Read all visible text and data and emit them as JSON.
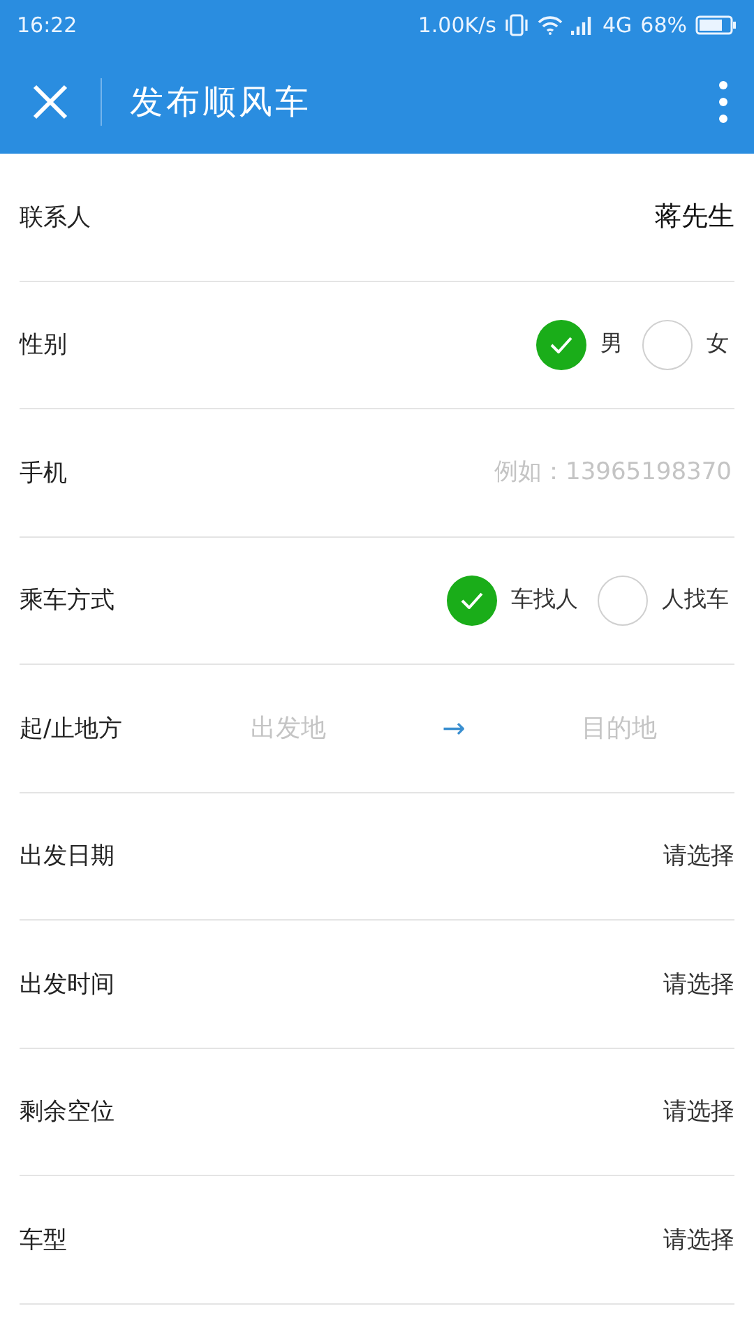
{
  "status_bar": {
    "time": "16:22",
    "speed": "1.00K/s",
    "network": "4G",
    "battery": "68%"
  },
  "header": {
    "title": "发布顺风车"
  },
  "rows": [
    {
      "kind": "text",
      "label": "联系人",
      "value": "蒋先生"
    },
    {
      "kind": "radio",
      "label": "性别",
      "options": [
        {
          "label": "男",
          "selected": true
        },
        {
          "label": "女",
          "selected": false
        }
      ]
    },
    {
      "kind": "input",
      "label": "手机",
      "placeholder": "例如：13965198370"
    },
    {
      "kind": "radio",
      "label": "乘车方式",
      "options": [
        {
          "label": "车找人",
          "selected": true
        },
        {
          "label": "人找车",
          "selected": false
        }
      ]
    },
    {
      "kind": "route",
      "label": "起/止地方",
      "from_placeholder": "出发地",
      "arrow": "→",
      "to_placeholder": "目的地"
    },
    {
      "kind": "picker",
      "label": "出发日期",
      "value": "请选择"
    },
    {
      "kind": "picker",
      "label": "出发时间",
      "value": "请选择"
    },
    {
      "kind": "picker",
      "label": "剩余空位",
      "value": "请选择"
    },
    {
      "kind": "picker",
      "label": "车型",
      "value": "请选择"
    }
  ]
}
